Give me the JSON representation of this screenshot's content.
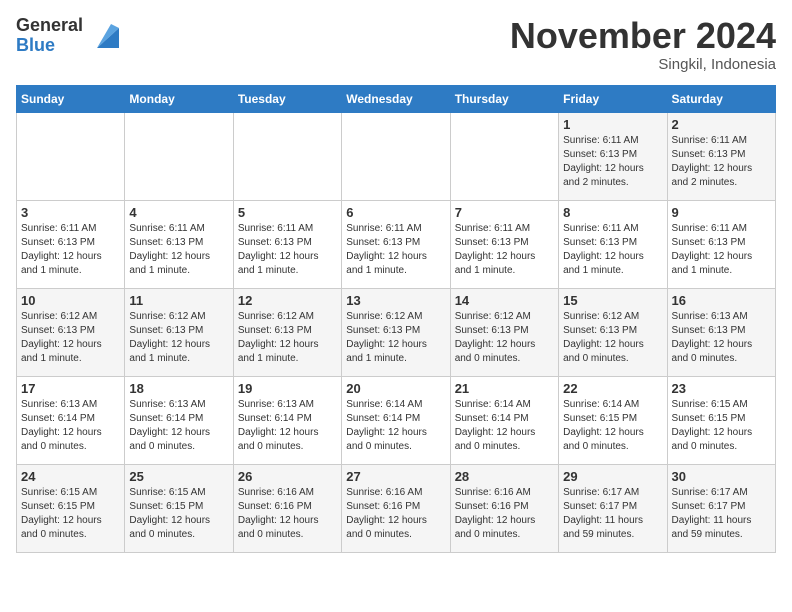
{
  "logo": {
    "general": "General",
    "blue": "Blue"
  },
  "title": "November 2024",
  "subtitle": "Singkil, Indonesia",
  "days_of_week": [
    "Sunday",
    "Monday",
    "Tuesday",
    "Wednesday",
    "Thursday",
    "Friday",
    "Saturday"
  ],
  "weeks": [
    [
      {
        "day": "",
        "info": ""
      },
      {
        "day": "",
        "info": ""
      },
      {
        "day": "",
        "info": ""
      },
      {
        "day": "",
        "info": ""
      },
      {
        "day": "",
        "info": ""
      },
      {
        "day": "1",
        "info": "Sunrise: 6:11 AM\nSunset: 6:13 PM\nDaylight: 12 hours\nand 2 minutes."
      },
      {
        "day": "2",
        "info": "Sunrise: 6:11 AM\nSunset: 6:13 PM\nDaylight: 12 hours\nand 2 minutes."
      }
    ],
    [
      {
        "day": "3",
        "info": "Sunrise: 6:11 AM\nSunset: 6:13 PM\nDaylight: 12 hours\nand 1 minute."
      },
      {
        "day": "4",
        "info": "Sunrise: 6:11 AM\nSunset: 6:13 PM\nDaylight: 12 hours\nand 1 minute."
      },
      {
        "day": "5",
        "info": "Sunrise: 6:11 AM\nSunset: 6:13 PM\nDaylight: 12 hours\nand 1 minute."
      },
      {
        "day": "6",
        "info": "Sunrise: 6:11 AM\nSunset: 6:13 PM\nDaylight: 12 hours\nand 1 minute."
      },
      {
        "day": "7",
        "info": "Sunrise: 6:11 AM\nSunset: 6:13 PM\nDaylight: 12 hours\nand 1 minute."
      },
      {
        "day": "8",
        "info": "Sunrise: 6:11 AM\nSunset: 6:13 PM\nDaylight: 12 hours\nand 1 minute."
      },
      {
        "day": "9",
        "info": "Sunrise: 6:11 AM\nSunset: 6:13 PM\nDaylight: 12 hours\nand 1 minute."
      }
    ],
    [
      {
        "day": "10",
        "info": "Sunrise: 6:12 AM\nSunset: 6:13 PM\nDaylight: 12 hours\nand 1 minute."
      },
      {
        "day": "11",
        "info": "Sunrise: 6:12 AM\nSunset: 6:13 PM\nDaylight: 12 hours\nand 1 minute."
      },
      {
        "day": "12",
        "info": "Sunrise: 6:12 AM\nSunset: 6:13 PM\nDaylight: 12 hours\nand 1 minute."
      },
      {
        "day": "13",
        "info": "Sunrise: 6:12 AM\nSunset: 6:13 PM\nDaylight: 12 hours\nand 1 minute."
      },
      {
        "day": "14",
        "info": "Sunrise: 6:12 AM\nSunset: 6:13 PM\nDaylight: 12 hours\nand 0 minutes."
      },
      {
        "day": "15",
        "info": "Sunrise: 6:12 AM\nSunset: 6:13 PM\nDaylight: 12 hours\nand 0 minutes."
      },
      {
        "day": "16",
        "info": "Sunrise: 6:13 AM\nSunset: 6:13 PM\nDaylight: 12 hours\nand 0 minutes."
      }
    ],
    [
      {
        "day": "17",
        "info": "Sunrise: 6:13 AM\nSunset: 6:14 PM\nDaylight: 12 hours\nand 0 minutes."
      },
      {
        "day": "18",
        "info": "Sunrise: 6:13 AM\nSunset: 6:14 PM\nDaylight: 12 hours\nand 0 minutes."
      },
      {
        "day": "19",
        "info": "Sunrise: 6:13 AM\nSunset: 6:14 PM\nDaylight: 12 hours\nand 0 minutes."
      },
      {
        "day": "20",
        "info": "Sunrise: 6:14 AM\nSunset: 6:14 PM\nDaylight: 12 hours\nand 0 minutes."
      },
      {
        "day": "21",
        "info": "Sunrise: 6:14 AM\nSunset: 6:14 PM\nDaylight: 12 hours\nand 0 minutes."
      },
      {
        "day": "22",
        "info": "Sunrise: 6:14 AM\nSunset: 6:15 PM\nDaylight: 12 hours\nand 0 minutes."
      },
      {
        "day": "23",
        "info": "Sunrise: 6:15 AM\nSunset: 6:15 PM\nDaylight: 12 hours\nand 0 minutes."
      }
    ],
    [
      {
        "day": "24",
        "info": "Sunrise: 6:15 AM\nSunset: 6:15 PM\nDaylight: 12 hours\nand 0 minutes."
      },
      {
        "day": "25",
        "info": "Sunrise: 6:15 AM\nSunset: 6:15 PM\nDaylight: 12 hours\nand 0 minutes."
      },
      {
        "day": "26",
        "info": "Sunrise: 6:16 AM\nSunset: 6:16 PM\nDaylight: 12 hours\nand 0 minutes."
      },
      {
        "day": "27",
        "info": "Sunrise: 6:16 AM\nSunset: 6:16 PM\nDaylight: 12 hours\nand 0 minutes."
      },
      {
        "day": "28",
        "info": "Sunrise: 6:16 AM\nSunset: 6:16 PM\nDaylight: 12 hours\nand 0 minutes."
      },
      {
        "day": "29",
        "info": "Sunrise: 6:17 AM\nSunset: 6:17 PM\nDaylight: 11 hours\nand 59 minutes."
      },
      {
        "day": "30",
        "info": "Sunrise: 6:17 AM\nSunset: 6:17 PM\nDaylight: 11 hours\nand 59 minutes."
      }
    ]
  ]
}
